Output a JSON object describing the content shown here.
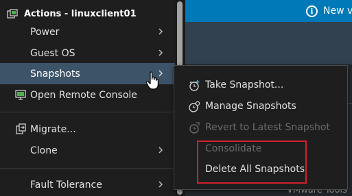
{
  "banner": {
    "text": "New v"
  },
  "background": {
    "bottom_text": "VMware Tools"
  },
  "menu": {
    "title": "Actions - linuxclient01",
    "items": [
      {
        "label": "Power",
        "has_submenu": true
      },
      {
        "label": "Guest OS",
        "has_submenu": true
      },
      {
        "label": "Snapshots",
        "has_submenu": true,
        "active": true
      },
      {
        "label": "Open Remote Console",
        "has_submenu": false
      },
      {
        "label": "Migrate...",
        "has_submenu": false
      },
      {
        "label": "Clone",
        "has_submenu": true
      },
      {
        "label": "Fault Tolerance",
        "has_submenu": true
      }
    ]
  },
  "submenu": {
    "items": [
      {
        "label": "Take Snapshot...",
        "enabled": true,
        "icon": "camera-clock-plus-icon"
      },
      {
        "label": "Manage Snapshots",
        "enabled": true,
        "icon": "camera-gear-icon"
      },
      {
        "label": "Revert to Latest Snapshot",
        "enabled": false,
        "icon": "camera-revert-icon"
      },
      {
        "label": "Consolidate",
        "enabled": false
      },
      {
        "label": "Delete All Snapshots",
        "enabled": true
      }
    ]
  },
  "colors": {
    "menu_bg": "#1e1e1e",
    "active_item": "#3d5468",
    "banner": "#0079b8",
    "highlight_box": "#d0202c",
    "disabled_text": "#6b6b6b"
  }
}
